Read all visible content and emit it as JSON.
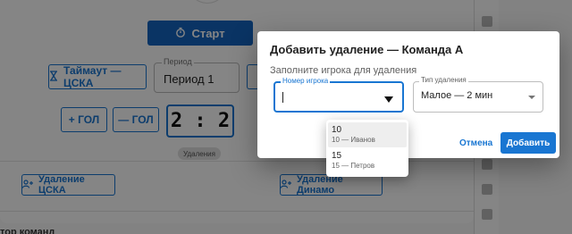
{
  "background": {
    "start_label": "Старт",
    "timeout_label": "Таймаут — ЦСКА",
    "period_label": "Период",
    "period_value": "Период 1",
    "goal_plus_label": "+ ГОЛ",
    "goal_minus_label": "— ГОЛ",
    "score": "2 : 2",
    "penalty_chip": "Удаления",
    "penalty_left_label": "Удаление ЦСКА",
    "penalty_right_label": "Удаление Динамо",
    "section_heading": "тор команд"
  },
  "dialog": {
    "title": "Добавить удаление — Команда A",
    "subtitle": "Заполните игрока для удаления",
    "player_field_label": "Номер игрока",
    "player_field_value": "",
    "type_field_label": "Тип удаления",
    "type_field_value": "Малое — 2 мин",
    "cancel_label": "Отмена",
    "add_label": "Добавить"
  },
  "menu": {
    "options": [
      {
        "number": "10",
        "detail": "10 — Иванов"
      },
      {
        "number": "15",
        "detail": "15 — Петров"
      }
    ],
    "highlighted_index": 0
  },
  "colors": {
    "accent": "#1976d2",
    "overlay": "rgba(0,0,0,0.48)"
  }
}
